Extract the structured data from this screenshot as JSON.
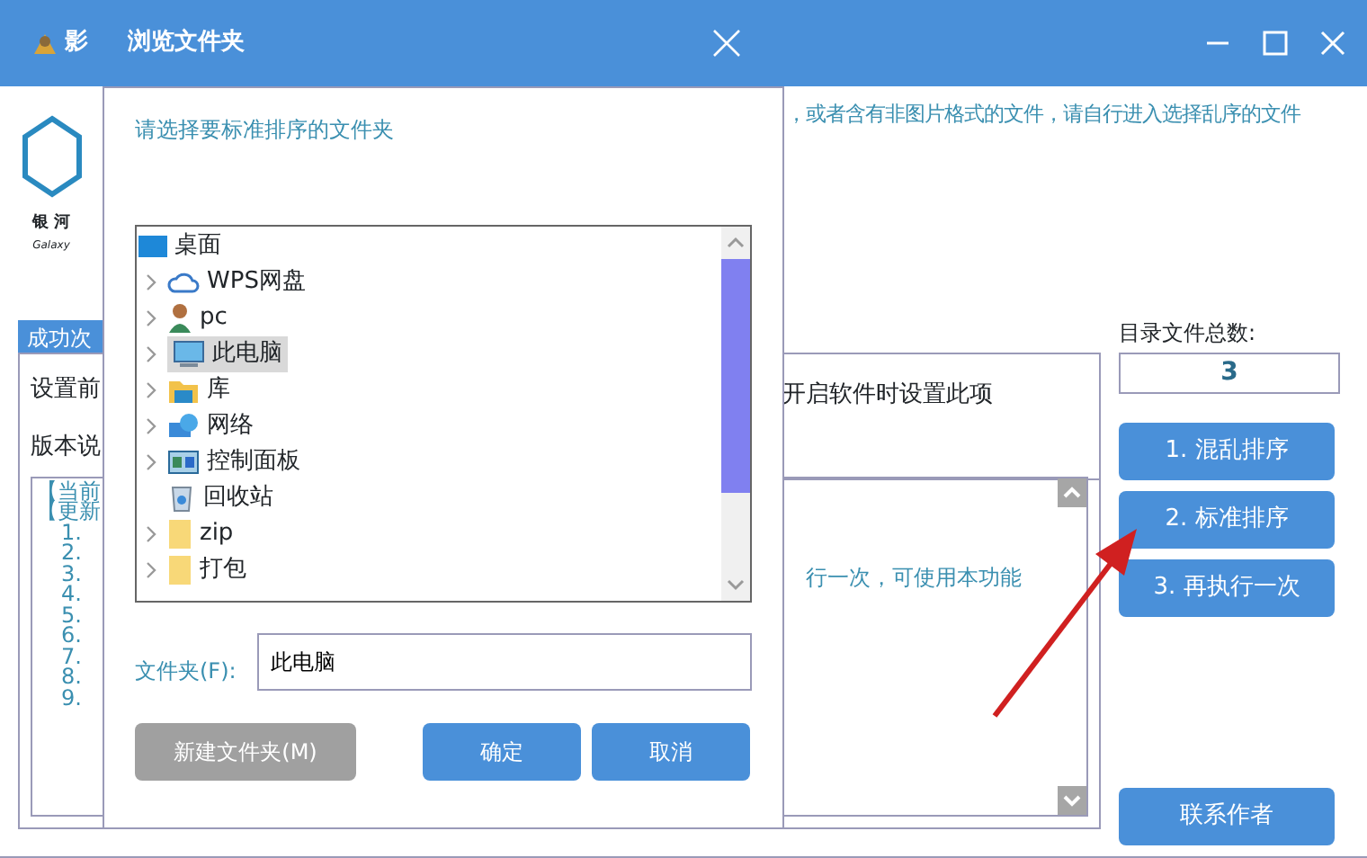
{
  "main_window": {
    "title": "影",
    "logo_text": "银 河",
    "logo_subtext": "Galaxy",
    "notice": "，或者含有非图片格式的文件，请自行进入选择乱序的文件",
    "tab": {
      "label": "成功次",
      "selected": true
    },
    "settings_label": "设置前",
    "option_note": "开启软件时设置此项",
    "version_label": "版本说",
    "version_lines": [
      "【当前",
      "【更新",
      "1.",
      "2.",
      "3.",
      "4.",
      "5.",
      "6.",
      "7.",
      "8.",
      "9."
    ],
    "log_text": "行一次，可使用本功能",
    "file_count_label": "目录文件总数:",
    "file_count": "3",
    "buttons": [
      "1. 混乱排序",
      "2. 标准排序",
      "3. 再执行一次"
    ],
    "contact_button": "联系作者"
  },
  "dialog": {
    "title": "浏览文件夹",
    "prompt": "请选择要标准排序的文件夹",
    "tree": [
      {
        "label": "桌面",
        "kind": "desktop",
        "selected": false,
        "children": [
          {
            "label": "WPS网盘",
            "kind": "cloud",
            "expandable": true,
            "selected": false
          },
          {
            "label": "pc",
            "kind": "user",
            "expandable": true,
            "selected": false
          },
          {
            "label": "此电脑",
            "kind": "computer",
            "expandable": true,
            "selected": true
          },
          {
            "label": "库",
            "kind": "library",
            "expandable": true,
            "selected": false
          },
          {
            "label": "网络",
            "kind": "network",
            "expandable": true,
            "selected": false
          },
          {
            "label": "控制面板",
            "kind": "panel",
            "expandable": true,
            "selected": false
          },
          {
            "label": "回收站",
            "kind": "bin",
            "expandable": false,
            "selected": false
          },
          {
            "label": "zip",
            "kind": "folder",
            "expandable": true,
            "selected": false
          },
          {
            "label": "打包",
            "kind": "folder",
            "expandable": true,
            "selected": false
          }
        ]
      }
    ],
    "folder_label": "文件夹(F):",
    "folder_value": "此电脑",
    "buttons": [
      {
        "label": "新建文件夹(M)",
        "kind": "secondary"
      },
      {
        "label": "确定",
        "kind": "primary"
      },
      {
        "label": "取消",
        "kind": "primary"
      }
    ]
  }
}
